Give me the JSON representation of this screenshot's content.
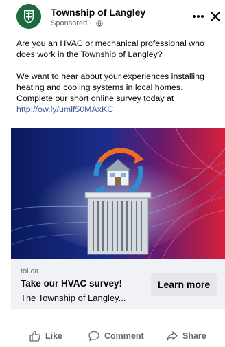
{
  "header": {
    "page_name": "Township of Langley",
    "sponsored_label": "Sponsored · "
  },
  "post": {
    "paragraph1": "Are you an HVAC or mechanical professional who does work in the Township of Langley?",
    "paragraph2": "We want to hear about your experiences installing heating and cooling systems in local homes. Complete our short online survey today at ",
    "link": "http://ow.ly/umlf50MAxKC"
  },
  "link_card": {
    "domain": "tol.ca",
    "headline": "Take our HVAC survey!",
    "description": "The Township of Langley...",
    "cta_label": "Learn more"
  },
  "actions": {
    "like": "Like",
    "comment": "Comment",
    "share": "Share"
  },
  "colors": {
    "brand_green": "#1d6b3d",
    "link_blue": "#385898",
    "arrow_orange": "#f26b21",
    "arrow_blue": "#2a8fd6"
  }
}
